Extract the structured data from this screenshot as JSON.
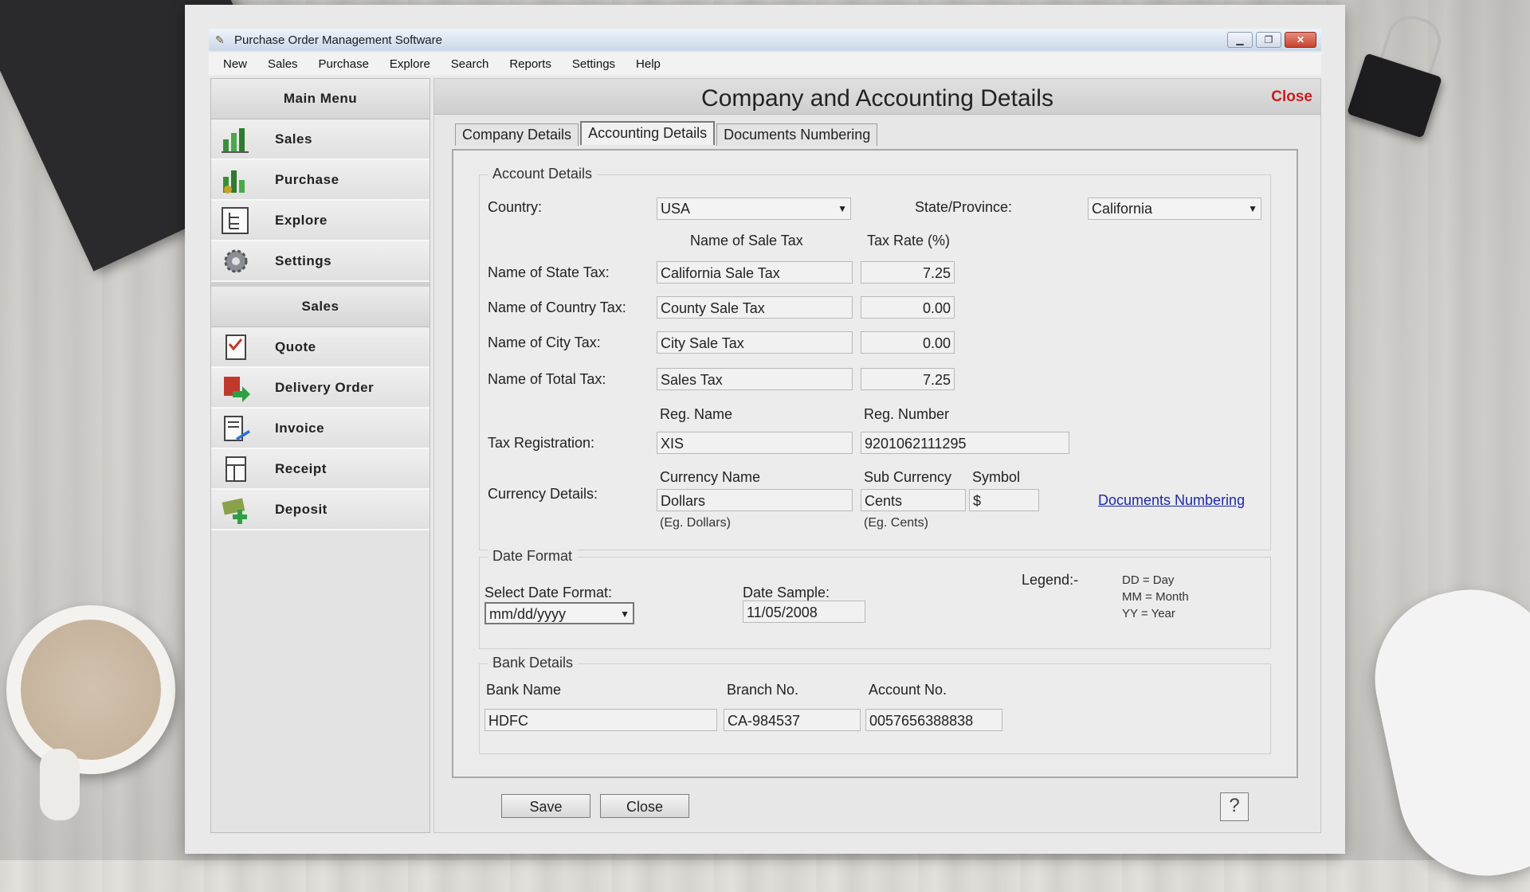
{
  "window": {
    "title": "Purchase Order Management Software"
  },
  "menubar": {
    "items": [
      "New",
      "Sales",
      "Purchase",
      "Explore",
      "Search",
      "Reports",
      "Settings",
      "Help"
    ]
  },
  "sidebar": {
    "main_menu_title": "Main Menu",
    "main_items": [
      {
        "label": "Sales",
        "icon": "sales-chart-icon"
      },
      {
        "label": "Purchase",
        "icon": "purchase-chart-icon"
      },
      {
        "label": "Explore",
        "icon": "explore-tree-icon"
      },
      {
        "label": "Settings",
        "icon": "gear-icon"
      }
    ],
    "sales_title": "Sales",
    "sales_items": [
      {
        "label": "Quote",
        "icon": "quote-icon"
      },
      {
        "label": "Delivery Order",
        "icon": "delivery-order-icon"
      },
      {
        "label": "Invoice",
        "icon": "invoice-icon"
      },
      {
        "label": "Receipt",
        "icon": "receipt-icon"
      },
      {
        "label": "Deposit",
        "icon": "deposit-icon"
      }
    ]
  },
  "main": {
    "title": "Company and Accounting Details",
    "close_label": "Close",
    "tabs": [
      {
        "label": "Company Details",
        "active": false
      },
      {
        "label": "Accounting Details",
        "active": true
      },
      {
        "label": "Documents Numbering",
        "active": false
      }
    ]
  },
  "account": {
    "group_title": "Account Details",
    "country_label": "Country:",
    "country_value": "USA",
    "state_label": "State/Province:",
    "state_value": "California",
    "col_tax_name": "Name of Sale Tax",
    "col_tax_rate": "Tax Rate (%)",
    "taxes": [
      {
        "label": "Name of State Tax:",
        "name": "California Sale Tax",
        "rate": "7.25"
      },
      {
        "label": "Name of Country Tax:",
        "name": "County Sale Tax",
        "rate": "0.00"
      },
      {
        "label": "Name of City Tax:",
        "name": "City Sale Tax",
        "rate": "0.00"
      },
      {
        "label": "Name of Total Tax:",
        "name": "Sales Tax",
        "rate": "7.25"
      }
    ],
    "reg_name_header": "Reg. Name",
    "reg_number_header": "Reg. Number",
    "tax_reg_label": "Tax Registration:",
    "reg_name": "XIS",
    "reg_number": "9201062111295",
    "currency_label": "Currency Details:",
    "currency_name_header": "Currency Name",
    "sub_currency_header": "Sub Currency",
    "symbol_header": "Symbol",
    "currency_name": "Dollars",
    "sub_currency": "Cents",
    "symbol": "$",
    "currency_hint": "(Eg. Dollars)",
    "sub_currency_hint": "(Eg. Cents)",
    "doc_numbering_link": "Documents Numbering"
  },
  "date_format": {
    "group_title": "Date Format",
    "select_label": "Select Date Format:",
    "selected": "mm/dd/yyyy",
    "sample_label": "Date Sample:",
    "sample_value": "11/05/2008",
    "legend_label": "Legend:-",
    "legend": [
      "DD = Day",
      "MM = Month",
      "YY = Year"
    ]
  },
  "bank": {
    "group_title": "Bank Details",
    "bank_name_header": "Bank Name",
    "branch_header": "Branch No.",
    "account_header": "Account No.",
    "bank_name": "HDFC",
    "branch": "CA-984537",
    "account": "0057656388838"
  },
  "footer": {
    "save_label": "Save",
    "close_label": "Close",
    "help_label": "?"
  }
}
